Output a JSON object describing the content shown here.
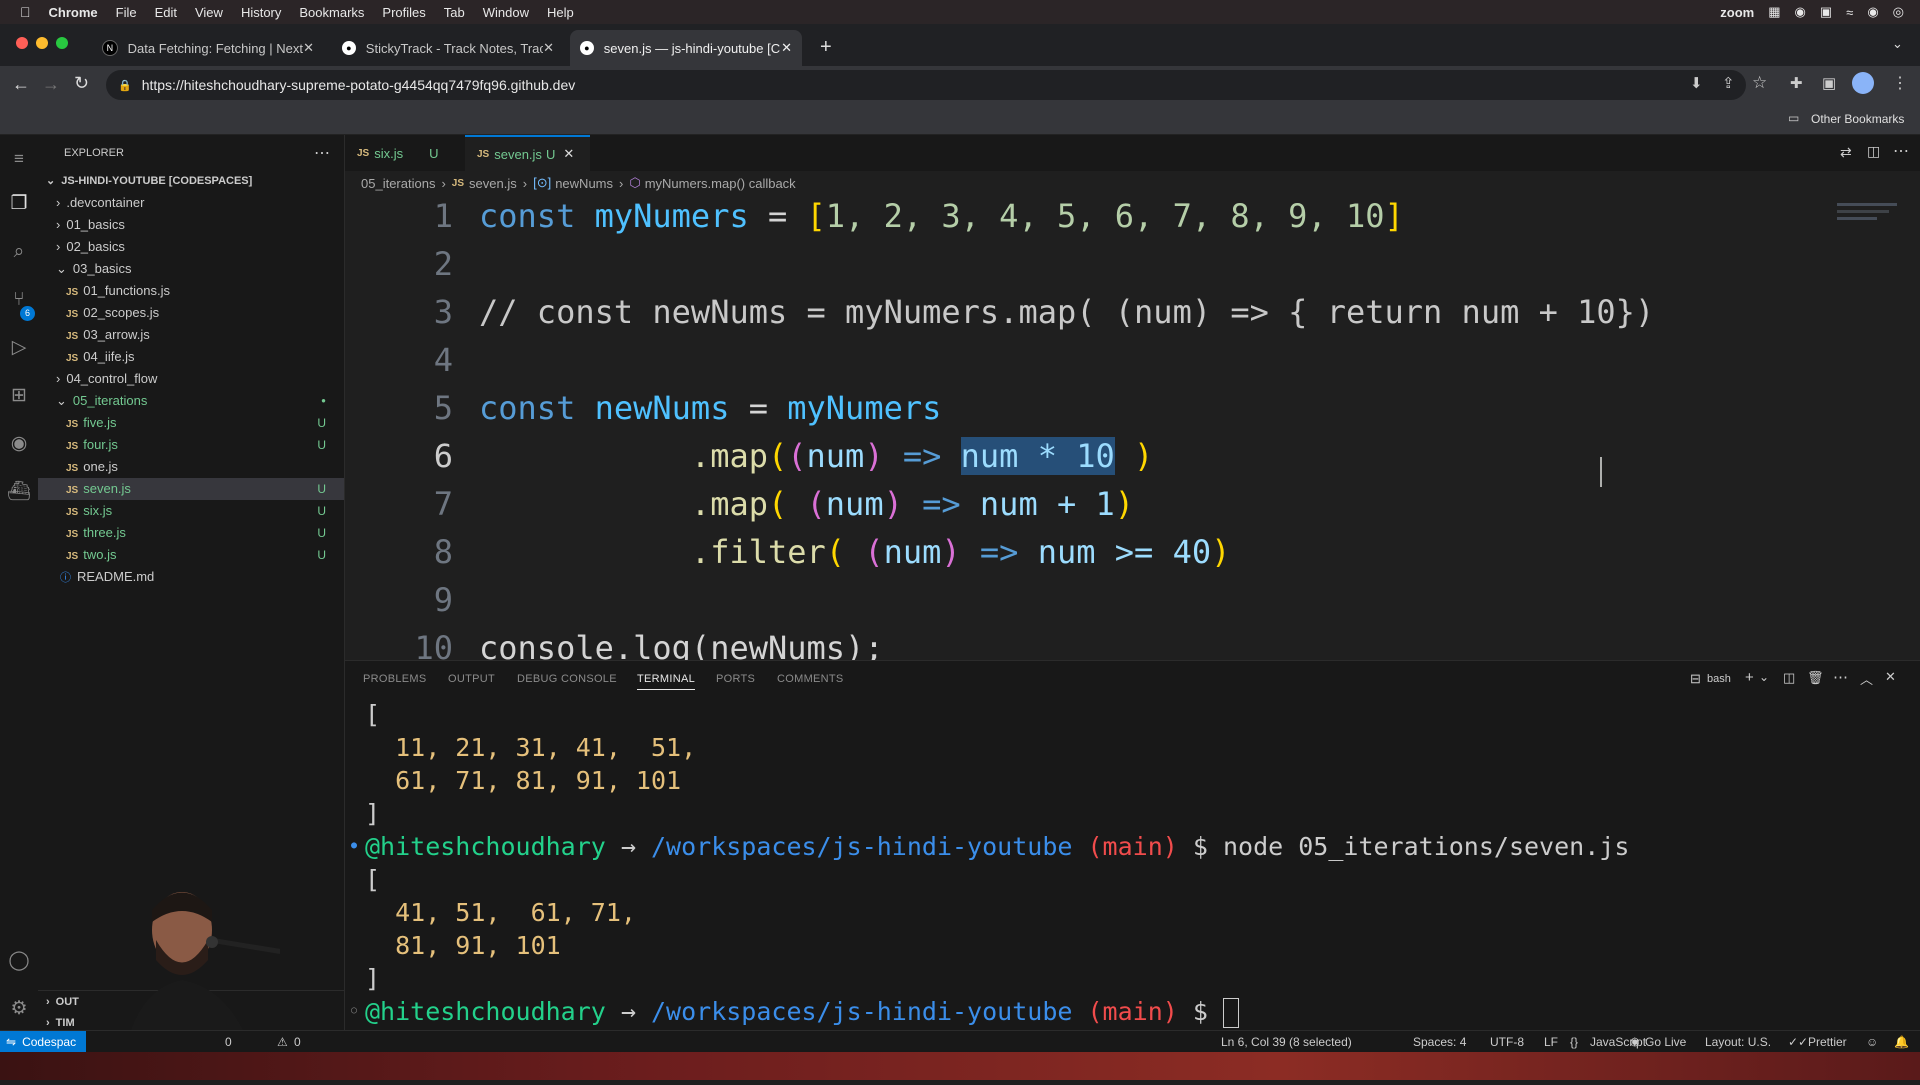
{
  "menubar": {
    "app": "Chrome",
    "items": [
      "File",
      "Edit",
      "View",
      "History",
      "Bookmarks",
      "Profiles",
      "Tab",
      "Window",
      "Help"
    ],
    "zoom": "zoom"
  },
  "browser": {
    "tabs": [
      {
        "title": "Data Fetching: Fetching | Next",
        "icon": "nextjs-icon"
      },
      {
        "title": "StickyTrack - Track Notes, Trac",
        "icon": "github-icon"
      },
      {
        "title": "seven.js — js-hindi-youtube [C",
        "icon": "github-icon"
      }
    ],
    "url": "https://hiteshchoudhary-supreme-potato-g4454qq7479fq96.github.dev",
    "other_bookmarks": "Other Bookmarks"
  },
  "explorer": {
    "title": "EXPLORER",
    "root": "JS-HINDI-YOUTUBE [CODESPACES]",
    "items": [
      {
        "label": ".devcontainer",
        "type": "folder"
      },
      {
        "label": "01_basics",
        "type": "folder"
      },
      {
        "label": "02_basics",
        "type": "folder"
      },
      {
        "label": "03_basics",
        "type": "folder-open"
      },
      {
        "label": "01_functions.js",
        "type": "js"
      },
      {
        "label": "02_scopes.js",
        "type": "js"
      },
      {
        "label": "03_arrow.js",
        "type": "js"
      },
      {
        "label": "04_iife.js",
        "type": "js"
      },
      {
        "label": "04_control_flow",
        "type": "folder"
      },
      {
        "label": "05_iterations",
        "type": "folder-open"
      },
      {
        "label": "five.js",
        "type": "js",
        "badge": "U"
      },
      {
        "label": "four.js",
        "type": "js",
        "badge": "U"
      },
      {
        "label": "one.js",
        "type": "js"
      },
      {
        "label": "seven.js",
        "type": "js",
        "badge": "U"
      },
      {
        "label": "six.js",
        "type": "js",
        "badge": "U"
      },
      {
        "label": "three.js",
        "type": "js",
        "badge": "U"
      },
      {
        "label": "two.js",
        "type": "js",
        "badge": "U"
      },
      {
        "label": "README.md",
        "type": "md"
      }
    ],
    "outline": "OUT",
    "timeline": "TIM",
    "scm_count": "6"
  },
  "editor": {
    "tabs": [
      {
        "label": "six.js",
        "badge": "U"
      },
      {
        "label": "seven.js",
        "badge": "U"
      }
    ],
    "breadcrumb": [
      "05_iterations",
      "seven.js",
      "newNums",
      "myNumers.map() callback"
    ],
    "line_numbers": [
      "1",
      "2",
      "3",
      "4",
      "5",
      "6",
      "7",
      "8",
      "9",
      "10"
    ],
    "code": {
      "l1": {
        "kw": "const",
        "var": "myNumers",
        "eq": " = ",
        "open": "[",
        "nums": "1, 2, 3, 4, 5, 6, 7, 8, 9, 10",
        "close": "]"
      },
      "l3": "// const newNums = myNumers.map( (num) => { return num + 10})",
      "l5": {
        "kw": "const",
        "var": "newNums",
        "eq": " = ",
        "src": "myNumers"
      },
      "l6": {
        "dot": ".map",
        "p1": "(",
        "p2": "(",
        "param": "num",
        "p3": ")",
        "arrow": " => ",
        "sel": "num * 10",
        "close": " )"
      },
      "l7": {
        "dot": ".map",
        "p1": "( ",
        "p2": "(",
        "param": "num",
        "p3": ")",
        "arrow": " => ",
        "body": "num + 1",
        "close": ")"
      },
      "l8": {
        "dot": ".filter",
        "p1": "( ",
        "p2": "(",
        "param": "num",
        "p3": ")",
        "arrow": " => ",
        "body": "num >= 40",
        "close": ")"
      },
      "l10": "console.log(newNums);"
    }
  },
  "panel": {
    "tabs": [
      "PROBLEMS",
      "OUTPUT",
      "DEBUG CONSOLE",
      "TERMINAL",
      "PORTS",
      "COMMENTS"
    ],
    "active_tab": "TERMINAL",
    "shell": "bash",
    "terminal": {
      "out1_open": "[",
      "out1_row1": "  11, 21, 31, 41,  51,",
      "out1_row2": "  61, 71, 81, 91, 101",
      "out1_close": "]",
      "user": "@hiteshchoudhary",
      "arrow": " → ",
      "path": "/workspaces/js-hindi-youtube",
      "branch": "(main)",
      "prompt": "$",
      "command": "node 05_iterations/seven.js",
      "out2_open": "[",
      "out2_row1": "  41, 51,  61, 71,",
      "out2_row2": "  81, 91, 101",
      "out2_close": "]"
    }
  },
  "statusbar": {
    "remote": "Codespac",
    "errors": "0",
    "warnings": "0",
    "cursor": "Ln 6, Col 39 (8 selected)",
    "spaces": "Spaces: 4",
    "encoding": "UTF-8",
    "eol": "LF",
    "language": "JavaScript",
    "golive": "Go Live",
    "layout": "Layout: U.S.",
    "prettier": "Prettier"
  },
  "colors": {
    "accent": "#0078d4",
    "git_untracked": "#73c991",
    "selection": "#264f78"
  }
}
